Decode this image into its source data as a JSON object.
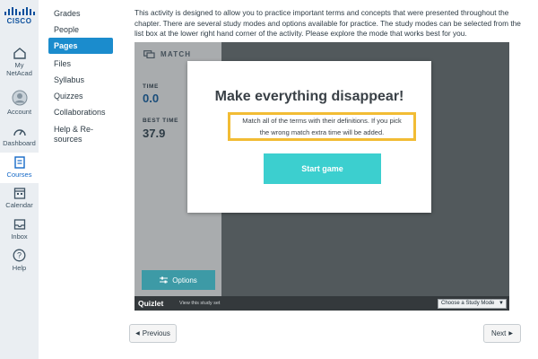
{
  "logo": {
    "text": "CISCO"
  },
  "global_nav": [
    {
      "label_lines": [
        "My",
        "NetAcad"
      ],
      "icon": "home-icon"
    },
    {
      "label_lines": [
        "Account"
      ],
      "icon": "account-icon"
    },
    {
      "label_lines": [
        "Dashboard"
      ],
      "icon": "dashboard-icon"
    },
    {
      "label_lines": [
        "Courses"
      ],
      "icon": "courses-icon",
      "active": true
    },
    {
      "label_lines": [
        "Calendar"
      ],
      "icon": "calendar-icon"
    },
    {
      "label_lines": [
        "Inbox"
      ],
      "icon": "inbox-icon"
    },
    {
      "label_lines": [
        "Help"
      ],
      "icon": "help-icon"
    }
  ],
  "course_nav": [
    {
      "label": "Grades"
    },
    {
      "label": "People"
    },
    {
      "label": "Pages",
      "active": true
    },
    {
      "label": "Files"
    },
    {
      "label": "Syllabus"
    },
    {
      "label": "Quizzes"
    },
    {
      "label": "Collaborations"
    },
    {
      "label_lines": [
        "Help & Re-",
        "sources"
      ]
    }
  ],
  "intro_text": "This activity is designed to allow you to practice important terms and concepts that were presented throughout the chapter. There are several study modes and options available for practice. The study modes can be selected from the list box at the lower right hand corner of the activity. Please explore the mode that works best for you.",
  "activity": {
    "mode_title": "MATCH",
    "time_label": "TIME",
    "time_value": "0.0",
    "best_time_label": "BEST TIME",
    "best_time_value": "37.9",
    "options_label": "Options",
    "brand": "Quizlet",
    "view_set_link": "View this study set",
    "study_mode_select": "Choose a Study Mode"
  },
  "modal": {
    "title": "Make everything disappear!",
    "description_lines": [
      "Match all of the terms with their definitions. If you pick",
      "the wrong match extra time will be added."
    ],
    "start_label": "Start game"
  },
  "pager": {
    "previous": "Previous",
    "next": "Next"
  },
  "colors": {
    "accent": "#1b8ccd",
    "rail_active": "#1569c7",
    "start_button": "#3ccfcf",
    "highlight": "#f2bc34",
    "options_button": "#3d9aa6"
  }
}
